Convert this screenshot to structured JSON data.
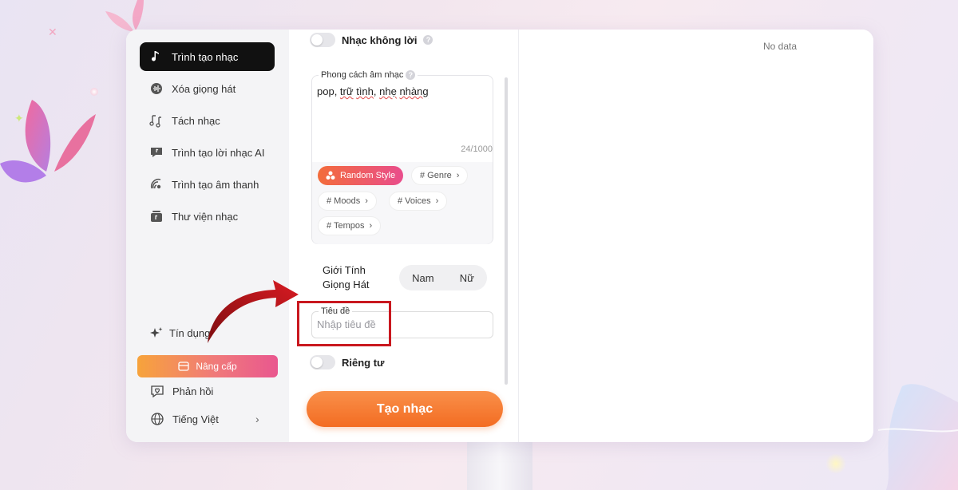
{
  "sidebar": {
    "items": [
      {
        "label": "Trình tạo nhạc",
        "icon": "music-note-icon",
        "active": true
      },
      {
        "label": "Xóa giọng hát",
        "icon": "vocal-remove-icon",
        "active": false
      },
      {
        "label": "Tách nhạc",
        "icon": "split-music-icon",
        "active": false
      },
      {
        "label": "Trình tạo lời nhạc AI",
        "icon": "lyrics-icon",
        "active": false
      },
      {
        "label": "Trình tạo âm thanh",
        "icon": "sound-wave-icon",
        "active": false
      },
      {
        "label": "Thư viện nhạc",
        "icon": "library-icon",
        "active": false
      }
    ],
    "credit_label": "Tín dụng",
    "upgrade_label": "Nâng cấp",
    "feedback_label": "Phản hồi",
    "language_label": "Tiếng Việt"
  },
  "form": {
    "instrumental_label": "Nhạc không lời",
    "instrumental_on": false,
    "style": {
      "label": "Phong cách âm nhạc",
      "value_parts": [
        "pop, ",
        "trữ",
        " ",
        "tình",
        ", ",
        "nhẹ",
        " ",
        "nhàng"
      ],
      "counter": "24/1000"
    },
    "chips": {
      "random": "Random Style",
      "genre": "# Genre",
      "moods": "# Moods",
      "voices": "# Voices",
      "tempos": "# Tempos"
    },
    "gender": {
      "label": "Giới Tính Giọng Hát",
      "male": "Nam",
      "female": "Nữ"
    },
    "title": {
      "label": "Tiêu đề",
      "placeholder": "Nhập tiêu đề",
      "value": ""
    },
    "private_label": "Riêng tư",
    "private_on": false,
    "create_button": "Tạo nhạc"
  },
  "result": {
    "empty_text": "No data"
  },
  "colors": {
    "accent_orange": "#f36c22",
    "highlight_red": "#c9181f",
    "active_nav": "#111111"
  }
}
